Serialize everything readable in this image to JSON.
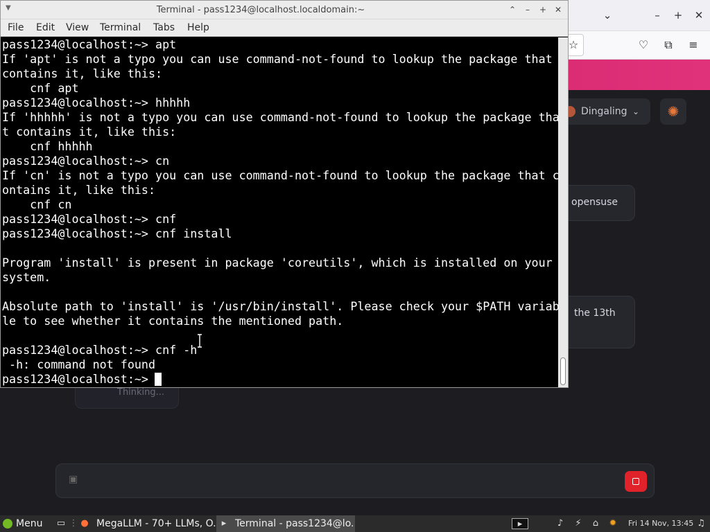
{
  "terminal": {
    "title": "Terminal - pass1234@localhost.localdomain:~",
    "menu": [
      "File",
      "Edit",
      "View",
      "Terminal",
      "Tabs",
      "Help"
    ],
    "lines": [
      "pass1234@localhost:~> apt",
      "If 'apt' is not a typo you can use command-not-found to lookup the package that",
      "contains it, like this:",
      "    cnf apt",
      "pass1234@localhost:~> hhhhh",
      "If 'hhhhh' is not a typo you can use command-not-found to lookup the package tha",
      "t contains it, like this:",
      "    cnf hhhhh",
      "pass1234@localhost:~> cn",
      "If 'cn' is not a typo you can use command-not-found to lookup the package that c",
      "ontains it, like this:",
      "    cnf cn",
      "pass1234@localhost:~> cnf",
      "pass1234@localhost:~> cnf install",
      "",
      "Program 'install' is present in package 'coreutils', which is installed on your",
      "system.",
      "",
      "Absolute path to 'install' is '/usr/bin/install'. Please check your $PATH variab",
      "le to see whether it contains the mentioned path.",
      "",
      "pass1234@localhost:~> cnf -h",
      " -h: command not found",
      "pass1234@localhost:~> "
    ]
  },
  "browser": {
    "model_selector": "Dingaling",
    "message_1": "opensuse",
    "message_2": "the 13th",
    "thinking": "Thinking..."
  },
  "taskbar": {
    "menu_label": "Menu",
    "task_browser": "MegaLLM - 70+ LLMs, O...",
    "task_terminal": "Terminal - pass1234@lo...",
    "clock": "Fri 14 Nov, 13:45"
  },
  "colors": {
    "accent_pink": "#d81b60",
    "send_button": "#e0232a",
    "opensuse_green": "#73ba25"
  }
}
